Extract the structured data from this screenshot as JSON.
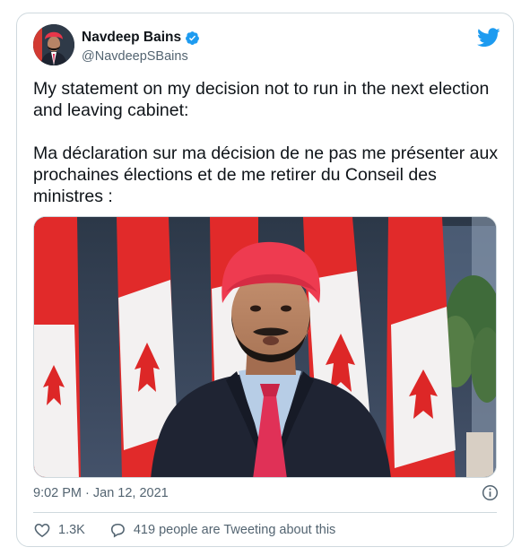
{
  "tweet": {
    "author": {
      "name": "Navdeep Bains",
      "handle": "@NavdeepSBains",
      "verified": true
    },
    "text": "My statement on my decision not to run in the next election and leaving cabinet:\n\nMa déclaration sur ma décision de ne pas me présenter aux prochaines élections et de me retirer du Conseil des ministres :",
    "timestamp": "9:02 PM · Jan 12, 2021",
    "likes": "1.3K",
    "conversation": "419 people are Tweeting about this"
  },
  "colors": {
    "brand": "#1d9bf0",
    "text_primary": "#0f1419",
    "text_secondary": "#536471",
    "border": "#cfd9de"
  },
  "icons": [
    "verified-badge-icon",
    "twitter-bird-icon",
    "info-icon",
    "heart-icon",
    "speech-bubble-icon"
  ]
}
